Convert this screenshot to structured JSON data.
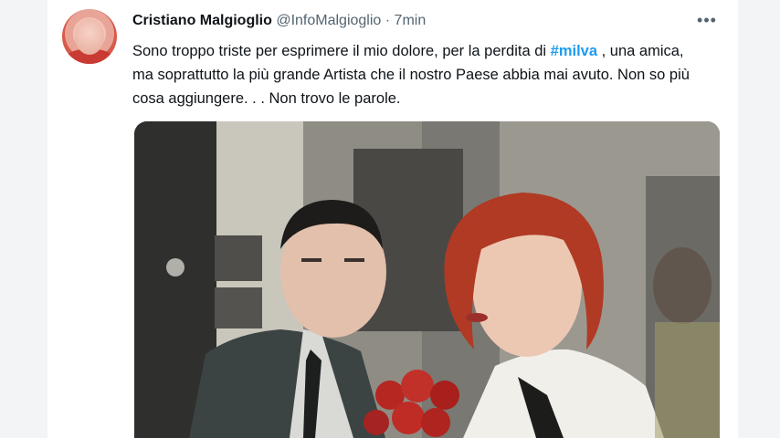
{
  "tweet": {
    "author_name": "Cristiano Malgioglio",
    "handle": "@InfoMalgioglio",
    "separator": "·",
    "time": "7min",
    "more_icon": "more-dots-icon",
    "more_glyph": "•••",
    "text_part1": "Sono troppo triste per esprimere il mio dolore, per la perdita  di ",
    "hashtag": "#milva",
    "text_part2": " , una amica, ma soprattutto  la più grande Artista che il nostro Paese abbia mai avuto. Non so più cosa aggiungere. . . Non trovo le parole."
  },
  "colors": {
    "hashtag": "#1d9bf0",
    "text": "#0f1419",
    "secondary": "#536471"
  }
}
